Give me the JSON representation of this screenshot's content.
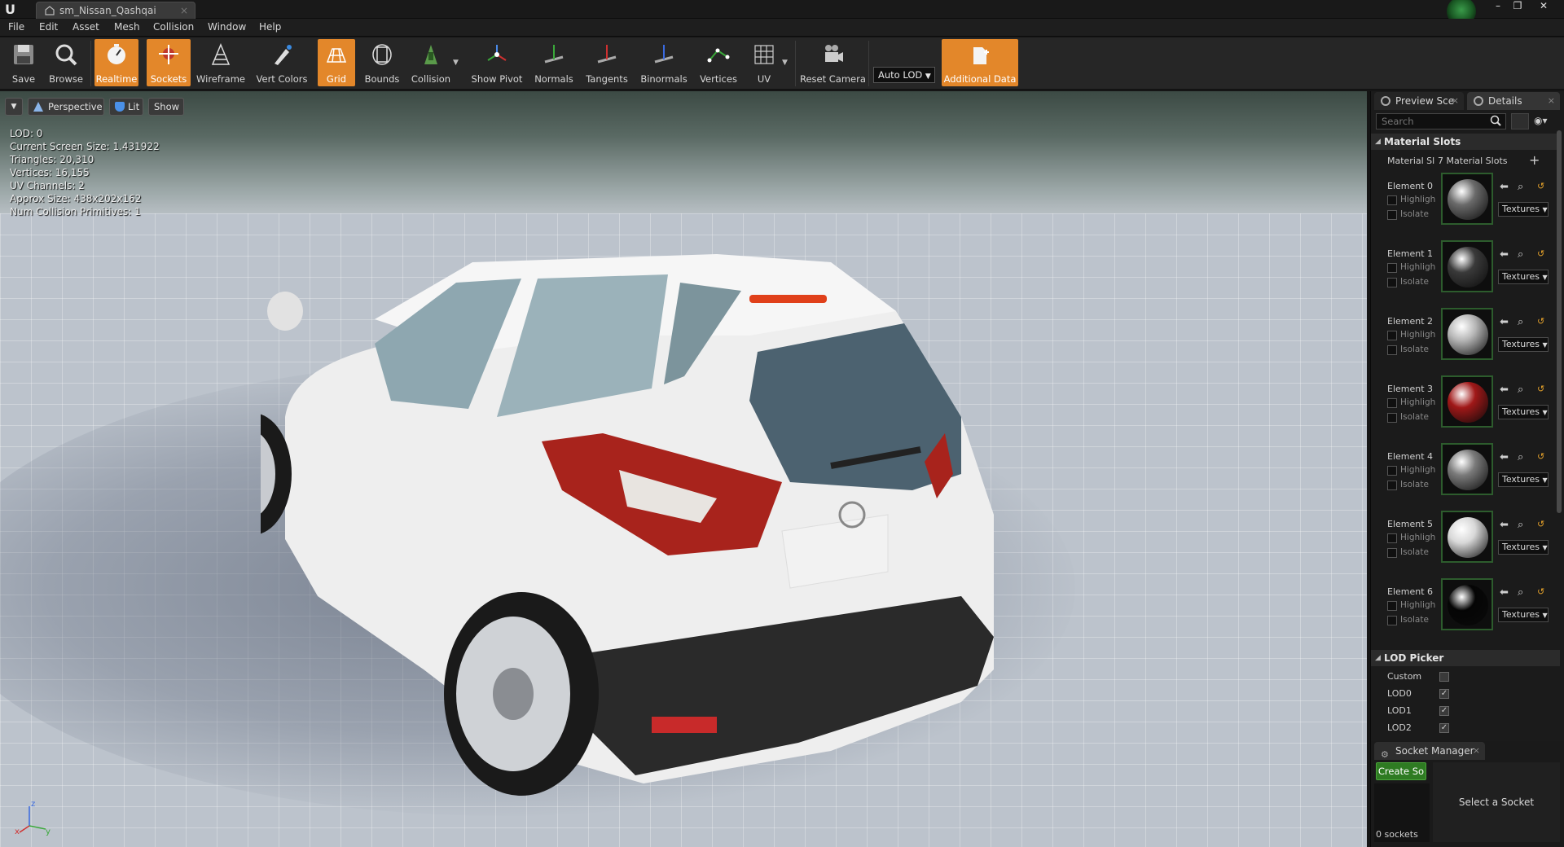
{
  "window": {
    "tab_title": "sm_Nissan_Qashqai",
    "tab_close": "×",
    "minimize": "–",
    "restore": "❐",
    "close": "✕"
  },
  "menu": [
    "File",
    "Edit",
    "Asset",
    "Mesh",
    "Collision",
    "Window",
    "Help"
  ],
  "toolbar": {
    "buttons": [
      {
        "label": "Save",
        "icon": "save-icon",
        "active": false
      },
      {
        "label": "Browse",
        "icon": "browse-icon",
        "active": false
      },
      {
        "label": "Realtime",
        "icon": "realtime-icon",
        "active": true
      },
      {
        "label": "Sockets",
        "icon": "sockets-icon",
        "active": true
      },
      {
        "label": "Wireframe",
        "icon": "wireframe-icon",
        "active": false
      },
      {
        "label": "Vert Colors",
        "icon": "vert-colors-icon",
        "active": false
      },
      {
        "label": "Grid",
        "icon": "grid-icon",
        "active": true
      },
      {
        "label": "Bounds",
        "icon": "bounds-icon",
        "active": false
      },
      {
        "label": "Collision",
        "icon": "collision-icon",
        "active": false
      },
      {
        "label": "Show Pivot",
        "icon": "pivot-icon",
        "active": false
      },
      {
        "label": "Normals",
        "icon": "normals-icon",
        "active": false
      },
      {
        "label": "Tangents",
        "icon": "tangents-icon",
        "active": false
      },
      {
        "label": "Binormals",
        "icon": "binormals-icon",
        "active": false
      },
      {
        "label": "Vertices",
        "icon": "vertices-icon",
        "active": false
      },
      {
        "label": "UV",
        "icon": "uv-icon",
        "active": false
      },
      {
        "label": "Reset Camera",
        "icon": "reset-camera-icon",
        "active": false
      },
      {
        "label": "Additional Data",
        "icon": "additional-data-icon",
        "active": true
      }
    ],
    "lod_select": "Auto LOD"
  },
  "viewport": {
    "perspective_label": "Perspective",
    "lit_label": "Lit",
    "show_label": "Show",
    "stats": [
      "LOD: 0",
      "Current Screen Size: 1.431922",
      "Triangles: 20,310",
      "Vertices: 16,155",
      "UV Channels: 2",
      "Approx Size: 438x202x162",
      "Num Collision Primitives: 1"
    ],
    "axis": {
      "x": "x",
      "y": "y",
      "z": "z"
    }
  },
  "panel": {
    "tabs": [
      {
        "label": "Preview Sce",
        "close": "×"
      },
      {
        "label": "Details",
        "close": "×"
      }
    ],
    "search_placeholder": "Search",
    "material_slots_header": "Material Slots",
    "material_slots_label": "Material Sl",
    "material_slots_count": "7 Material Slots",
    "add_symbol": "+",
    "highlight_label": "Highligh",
    "isolate_label": "Isolate",
    "textures_label": "Textures",
    "elements": [
      {
        "label": "Element 0",
        "ball": "#6a6a6a"
      },
      {
        "label": "Element 1",
        "ball": "#3a3a3a"
      },
      {
        "label": "Element 2",
        "ball": "#b8b8b8"
      },
      {
        "label": "Element 3",
        "ball": "#a01818"
      },
      {
        "label": "Element 4",
        "ball": "#7a7a7a"
      },
      {
        "label": "Element 5",
        "ball": "#d8d8d8"
      },
      {
        "label": "Element 6",
        "ball": "#050505"
      }
    ],
    "lod_picker_header": "LOD Picker",
    "lod_rows": [
      {
        "label": "Custom",
        "checked": false
      },
      {
        "label": "LOD0",
        "checked": true
      },
      {
        "label": "LOD1",
        "checked": true
      },
      {
        "label": "LOD2",
        "checked": true
      }
    ]
  },
  "socket_manager": {
    "title": "Socket Manager",
    "close": "×",
    "create_label": "Create So",
    "select_label": "Select a Socket",
    "count_label": "0 sockets"
  },
  "colors": {
    "accent": "#e3872a",
    "create_green": "#2e7b22",
    "thumb_border": "#2d5c2d"
  }
}
